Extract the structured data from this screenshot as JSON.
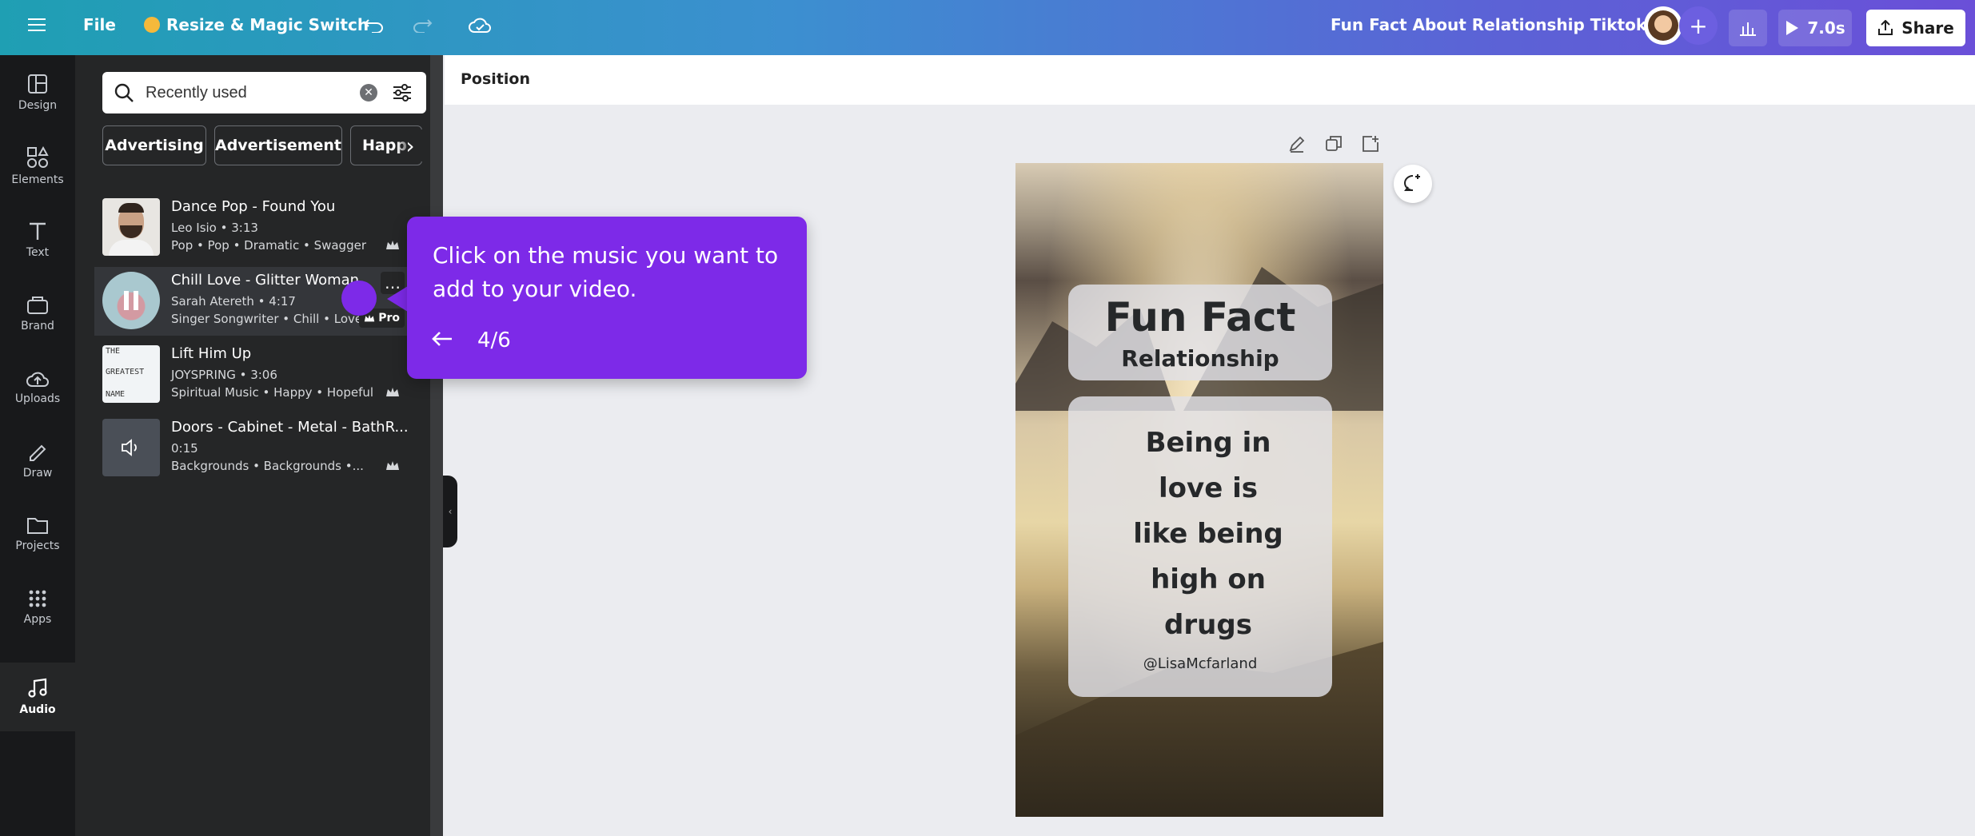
{
  "topbar": {
    "file_label": "File",
    "resize_label": "Resize & Magic Switch",
    "doc_title": "Fun Fact About Relationship Tiktok Video",
    "duration_label": "7.0s",
    "share_label": "Share"
  },
  "rail": {
    "items": [
      {
        "label": "Design",
        "icon": "layout-icon"
      },
      {
        "label": "Elements",
        "icon": "shapes-icon"
      },
      {
        "label": "Text",
        "icon": "text-icon"
      },
      {
        "label": "Brand",
        "icon": "brand-icon"
      },
      {
        "label": "Uploads",
        "icon": "cloud-upload-icon"
      },
      {
        "label": "Draw",
        "icon": "pen-icon"
      },
      {
        "label": "Projects",
        "icon": "folder-icon"
      },
      {
        "label": "Apps",
        "icon": "grid-icon"
      },
      {
        "label": "Audio",
        "icon": "music-note-icon"
      }
    ]
  },
  "panel": {
    "search_value": "Recently used",
    "chips": [
      "Advertising",
      "Advertisement",
      "Happ"
    ],
    "tracks": [
      {
        "title": "Dance Pop - Found You",
        "meta": "Leo Isio • 3:13",
        "tags": "Pop • Pop • Dramatic • Swagger",
        "pro": ""
      },
      {
        "title": "Chill Love - Glitter Woman",
        "meta": "Sarah Atereth • 4:17",
        "tags": "Singer Songwriter • Chill • Love",
        "pro": "Pro"
      },
      {
        "title": "Lift Him Up",
        "meta": "JOYSPRING • 3:06",
        "tags": "Spiritual Music • Happy • Hopeful",
        "pro": "",
        "thumb_text": [
          "THE",
          "GREATEST",
          "NAME"
        ]
      },
      {
        "title": "Doors - Cabinet - Metal - BathR...",
        "meta": "0:15",
        "tags": "Backgrounds • Backgrounds •...",
        "pro": ""
      }
    ]
  },
  "tooltip": {
    "text": "Click on the music you want to add to your video.",
    "step": "4/6"
  },
  "canvas": {
    "header_label": "Position",
    "title_line1": "Fun Fact",
    "title_line2": "Relationship",
    "quote_lines": [
      "Being in",
      "love is",
      "like being",
      "high on",
      "drugs"
    ],
    "handle": "@LisaMcfarland"
  },
  "colors": {
    "accent": "#7d2ae8",
    "rail_bg": "#18191b",
    "panel_bg": "#252627"
  }
}
